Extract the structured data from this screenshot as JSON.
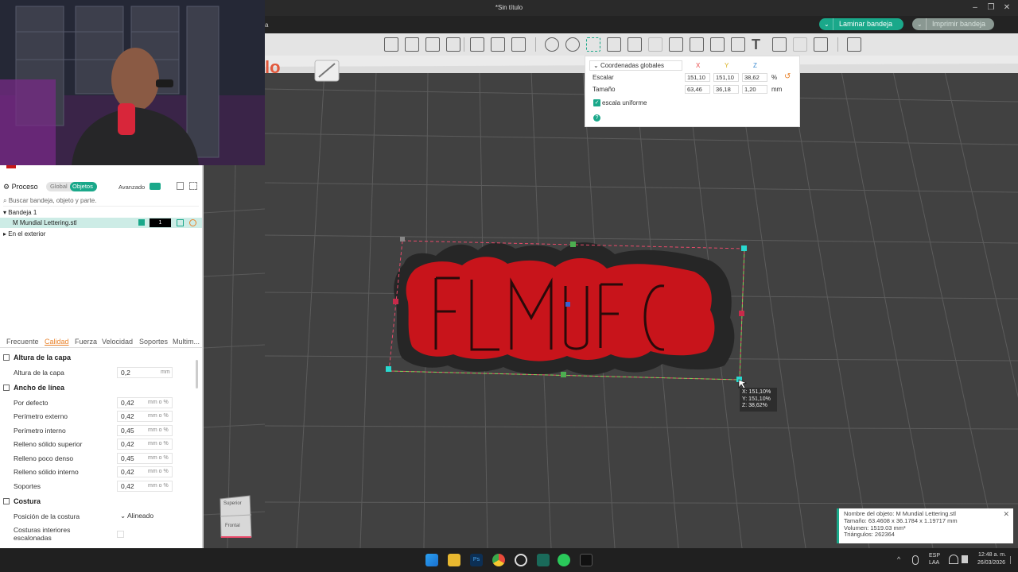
{
  "window": {
    "title": "*Sin título",
    "menu_fragment": "a",
    "minimize": "–",
    "maximize": "❐",
    "close": "✕"
  },
  "top_buttons": {
    "slice_label": "Laminar bandeja",
    "print_label": "Imprimir bandeja",
    "arrow": "⌄"
  },
  "toolbar": {
    "icons": [
      "add-cube-icon",
      "grid-icon",
      "orient-icon",
      "arrange-icon",
      "split-icon",
      "split-parts-icon",
      "layers-icon",
      "move-icon",
      "rotate-icon",
      "scale-icon",
      "erase-icon",
      "cut-icon",
      "boolean-icon",
      "support-paint-icon",
      "seam-paint-icon",
      "fuzzy-icon",
      "color-paint-icon",
      "text-icon",
      "measure-icon",
      "assembly-icon",
      "variable-layer-icon",
      "more-icon"
    ]
  },
  "left_panel": {
    "process_label": "Proceso",
    "global_label": "Global",
    "objects_label": "Objetos",
    "advanced_label": "Avanzado",
    "search_placeholder": "Buscar bandeja, objeto y parte.",
    "plate_label": "Bandeja 1",
    "object_name": "M Mundial Lettering.stl",
    "object_count": "1",
    "outside_label": "En el exterior",
    "tabs": [
      "Frecuente",
      "Calidad",
      "Fuerza",
      "Velocidad",
      "Soportes",
      "Multim..."
    ],
    "layer_height_section": "Altura de la capa",
    "layer_height_label": "Altura de la capa",
    "layer_height_value": "0,2",
    "layer_height_unit": "mm",
    "line_width_section": "Ancho de línea",
    "line_widths": [
      {
        "label": "Por defecto",
        "value": "0,42",
        "unit": "mm o %"
      },
      {
        "label": "Perímetro externo",
        "value": "0,42",
        "unit": "mm o %"
      },
      {
        "label": "Perímetro interno",
        "value": "0,45",
        "unit": "mm o %"
      },
      {
        "label": "Relleno sólido superior",
        "value": "0,42",
        "unit": "mm o %"
      },
      {
        "label": "Relleno poco denso",
        "value": "0,45",
        "unit": "mm o %"
      },
      {
        "label": "Relleno sólido interno",
        "value": "0,42",
        "unit": "mm o %"
      },
      {
        "label": "Soportes",
        "value": "0,42",
        "unit": "mm o %"
      }
    ],
    "seam_section": "Costura",
    "seam_position_label": "Posición de la costura",
    "seam_position_value": "Alineado",
    "seam_interior_label_1": "Costuras interiores",
    "seam_interior_label_2": "escalonadas"
  },
  "coord_panel": {
    "mode": "Coordenadas globales",
    "x": "X",
    "y": "Y",
    "z": "Z",
    "scale_label": "Escalar",
    "scale_x": "151,10",
    "scale_y": "151,10",
    "scale_z": "38,62",
    "scale_unit": "%",
    "size_label": "Tamaño",
    "size_x": "63,46",
    "size_y": "36,18",
    "size_z": "1,20",
    "size_unit": "mm",
    "uniform_label": "escala uniforme",
    "help": "?"
  },
  "tooltip": {
    "x": "X: 151,10%",
    "y": "Y: 151,10%",
    "z": "Z: 38,62%"
  },
  "info_box": {
    "name": "Nombre del objeto: M Mundial Lettering.stl",
    "size": "Tamaño: 63.4608 x 36.1784 x 1.19717 mm",
    "volume": "Volumen: 1519.03 mm³",
    "triangles": "Triángulos: 262364"
  },
  "navcube": {
    "top": "Superior",
    "front": "Frontal"
  },
  "taskbar": {
    "lang": "ESP",
    "layout": "LAA",
    "time": "12:48 a. m.",
    "date": "26/03/2026",
    "chevron": "^"
  },
  "colors": {
    "accent": "#1aa88a",
    "model": "#c8141b"
  }
}
